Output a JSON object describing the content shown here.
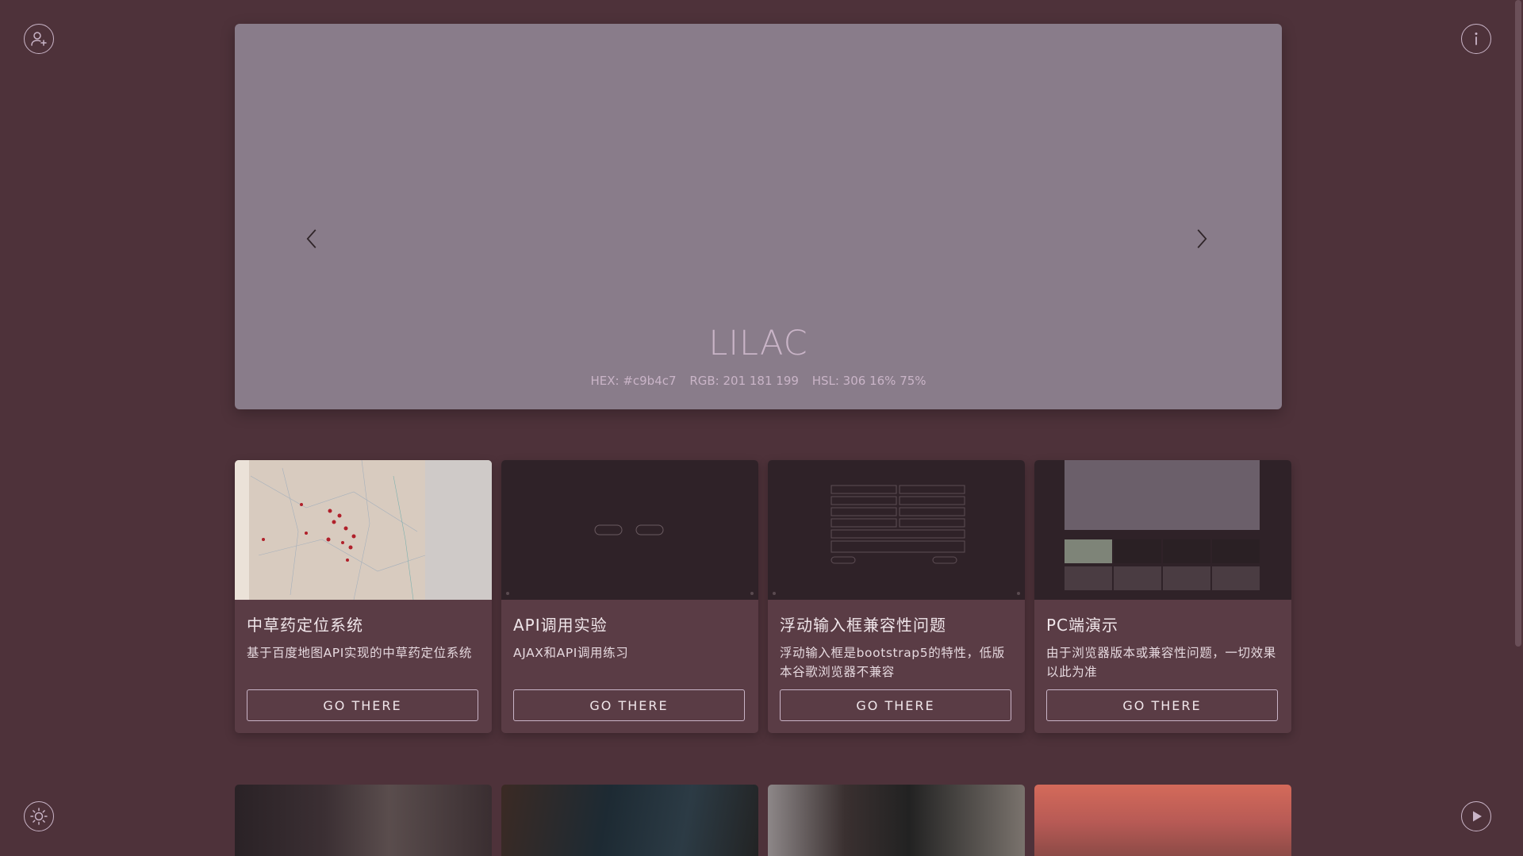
{
  "icons": {
    "user": "user-add-icon",
    "info": "info-icon",
    "theme": "sun-icon",
    "play": "play-icon",
    "prev": "chevron-left-icon",
    "next": "chevron-right-icon"
  },
  "colors": {
    "background": "#4e323a",
    "hero": "#897c8a",
    "accent": "#c9b4c7",
    "card": "#5a3c45"
  },
  "hero": {
    "title": "LILAC",
    "hex": "HEX: #c9b4c7",
    "rgb": "RGB: 201 181 199",
    "hsl": "HSL: 306 16% 75%",
    "slides": 2,
    "active_slide": 2
  },
  "cards": [
    {
      "title": "中草药定位系统",
      "desc": "基于百度地图API实现的中草药定位系统",
      "button": "GO THERE",
      "thumb": "map-screenshot"
    },
    {
      "title": "API调用实验",
      "desc": "AJAX和API调用练习",
      "button": "GO THERE",
      "thumb": "dark-page-screenshot"
    },
    {
      "title": "浮动输入框兼容性问题",
      "desc": "浮动输入框是bootstrap5的特性，低版本谷歌浏览器不兼容",
      "button": "GO THERE",
      "thumb": "form-screenshot"
    },
    {
      "title": "PC端演示",
      "desc": "由于浏览器版本或兼容性问题，一切效果以此为准",
      "button": "GO THERE",
      "thumb": "pc-page-screenshot"
    }
  ],
  "photos": [
    "photo-guitarist-studio",
    "photo-band-stage",
    "photo-guitar-closeup",
    "photo-sunset-portrait"
  ]
}
